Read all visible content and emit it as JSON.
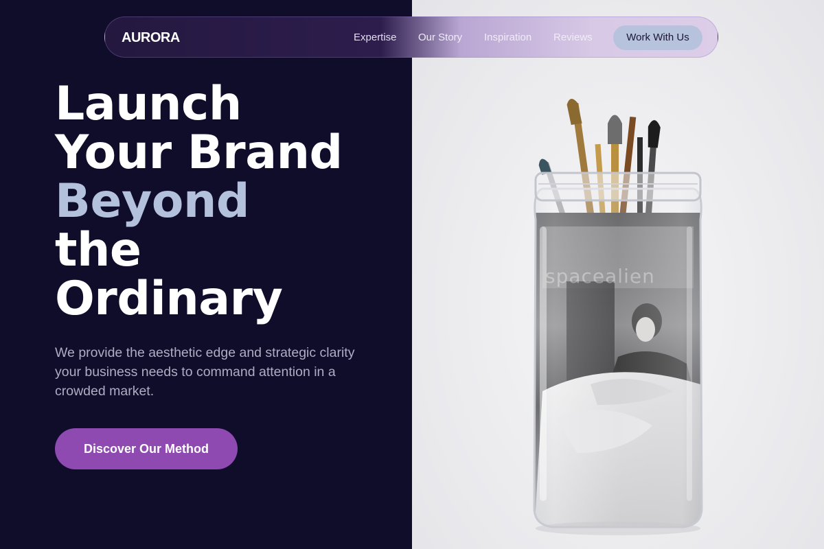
{
  "brand": {
    "name": "AURORA"
  },
  "nav": {
    "items": [
      {
        "label": "Expertise"
      },
      {
        "label": "Our Story"
      },
      {
        "label": "Inspiration"
      },
      {
        "label": "Reviews"
      }
    ],
    "cta_label": "Work With Us"
  },
  "hero": {
    "headline_lines": [
      "Launch",
      "Your Brand",
      "Beyond",
      "the",
      "Ordinary"
    ],
    "subtext": "We provide the aesthetic edge and strategic clarity your business needs to command attention in a crowded market.",
    "button_label": "Discover Our Method"
  },
  "image": {
    "watermark": "spacealien"
  },
  "colors": {
    "background": "#100d2b",
    "accent_text": "#b4c1dd",
    "primary_button": "#8e4ab1",
    "cta_pill": "#b7c3dd"
  },
  "icons": [
    "brush-jar-photo"
  ]
}
